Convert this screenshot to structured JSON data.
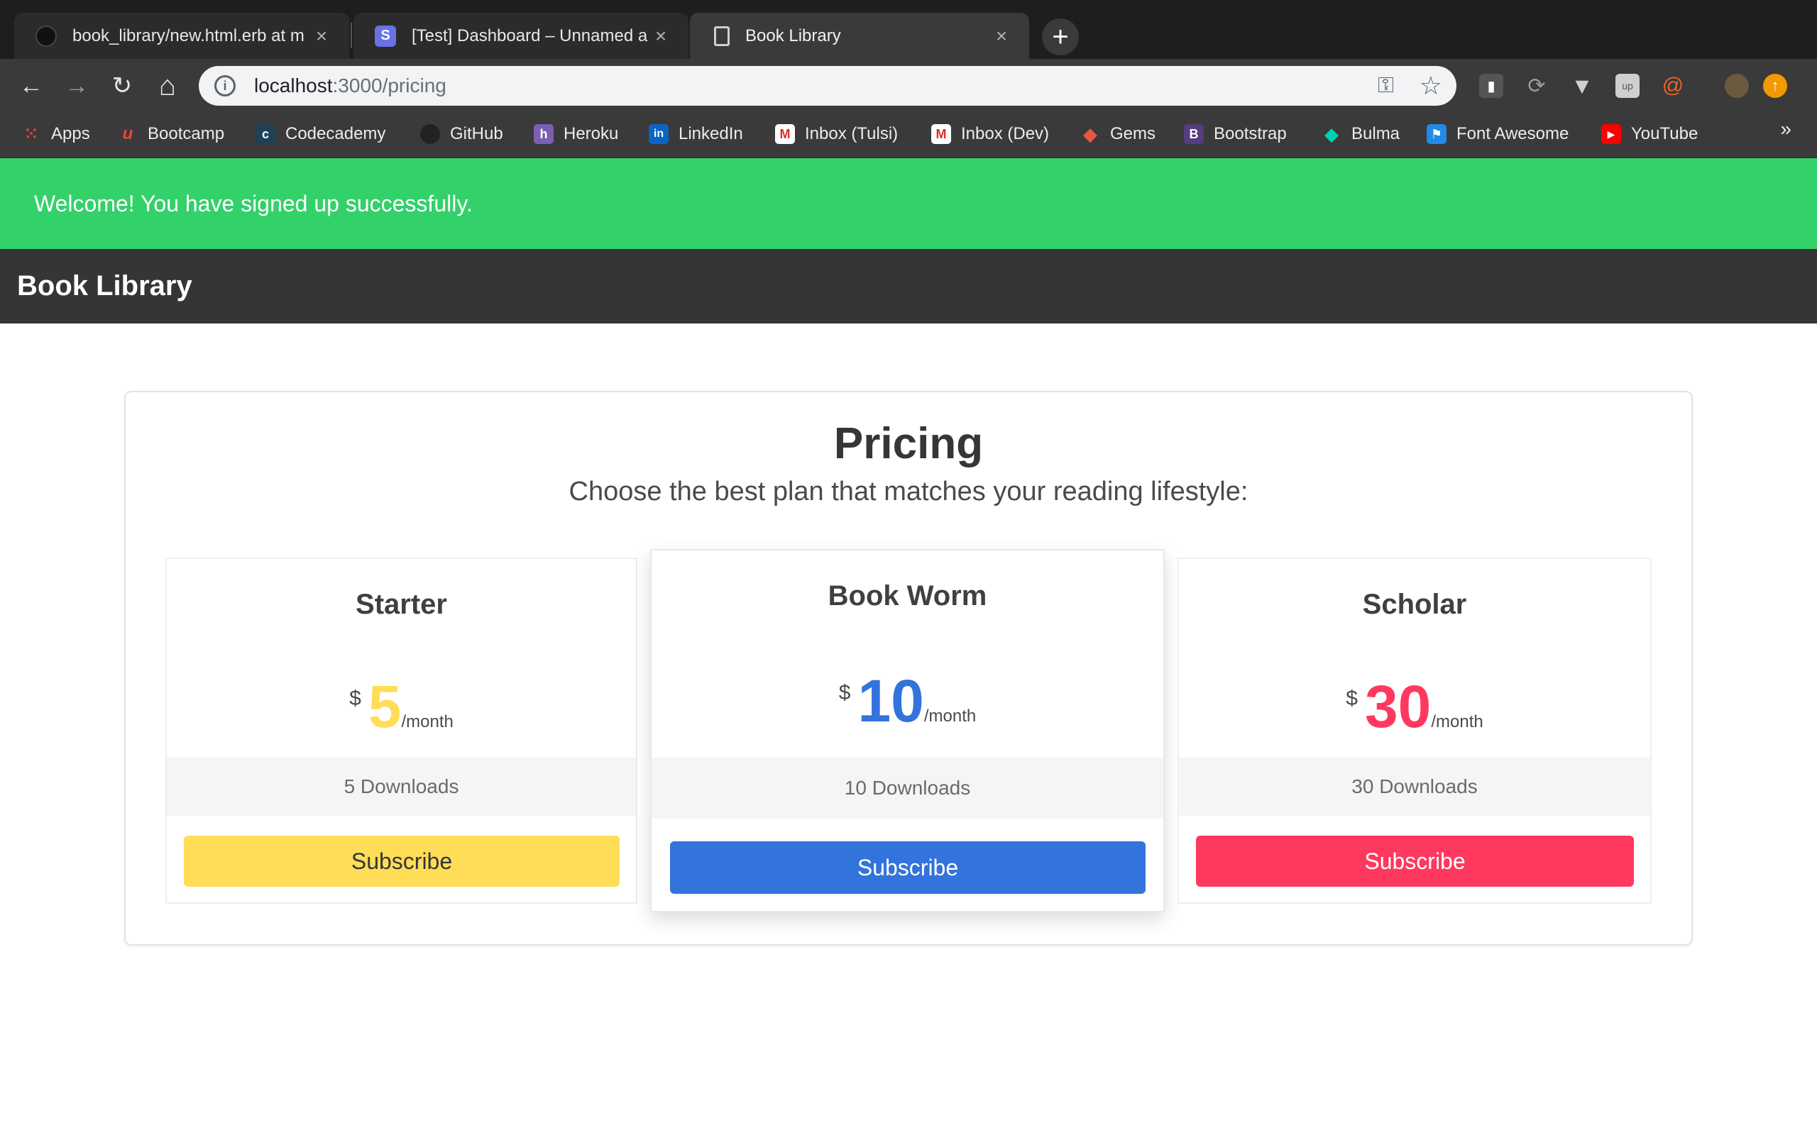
{
  "browser": {
    "tabs": [
      {
        "title": "book_library/new.html.erb at m",
        "icon": "github-icon",
        "active": false
      },
      {
        "title": "[Test] Dashboard – Unnamed a",
        "icon": "stripe-icon",
        "icon_glyph": "S",
        "active": false
      },
      {
        "title": "Book Library",
        "icon": "page-icon",
        "active": true
      }
    ],
    "new_tab_glyph": "+",
    "nav": {
      "back": "←",
      "forward": "→",
      "reload": "↻",
      "home": "⌂"
    },
    "url_host": "localhost",
    "url_rest": ":3000/pricing",
    "bookmarks": [
      {
        "label": "Apps",
        "icon": "apps-grid-icon",
        "color": "#e8453c"
      },
      {
        "label": "Bootcamp",
        "icon": "bootcamp-icon",
        "glyph": "u",
        "color": "#e8453c"
      },
      {
        "label": "Codecademy",
        "icon": "codecademy-icon",
        "glyph": "c",
        "color": "#1f4056"
      },
      {
        "label": "GitHub",
        "icon": "github-icon",
        "color": "#222222"
      },
      {
        "label": "Heroku",
        "icon": "heroku-icon",
        "glyph": "h",
        "color": "#7b5fb0"
      },
      {
        "label": "LinkedIn",
        "icon": "linkedin-icon",
        "glyph": "in",
        "color": "#0a66c2"
      },
      {
        "label": "Inbox (Tulsi)",
        "icon": "gmail-icon",
        "glyph": "M",
        "color": "#d93025"
      },
      {
        "label": "Inbox (Dev)",
        "icon": "gmail-icon",
        "glyph": "M",
        "color": "#d93025"
      },
      {
        "label": "Gems",
        "icon": "rubygems-icon",
        "glyph": "◆",
        "color": "#e9573f"
      },
      {
        "label": "Bootstrap",
        "icon": "bootstrap-icon",
        "glyph": "B",
        "color": "#563d7c"
      },
      {
        "label": "Bulma",
        "icon": "bulma-icon",
        "glyph": "◆",
        "color": "#00d1b2"
      },
      {
        "label": "Font Awesome",
        "icon": "font-awesome-icon",
        "glyph": "⚑",
        "color": "#228ae6"
      },
      {
        "label": "YouTube",
        "icon": "youtube-icon",
        "glyph": "▶",
        "color": "#ff0000"
      }
    ],
    "bookmarks_more": "»"
  },
  "flash": {
    "message": "Welcome! You have signed up successfully."
  },
  "navbar": {
    "brand": "Book Library"
  },
  "pricing": {
    "title": "Pricing",
    "subtitle": "Choose the best plan that matches your reading lifestyle:",
    "plans": [
      {
        "name": "Starter",
        "currency": "$",
        "amount": "5",
        "period": "/month",
        "feature": "5 Downloads",
        "cta": "Subscribe",
        "color": "#ffdd57",
        "cta_text_color": "#363636"
      },
      {
        "name": "Book Worm",
        "currency": "$",
        "amount": "10",
        "period": "/month",
        "feature": "10 Downloads",
        "cta": "Subscribe",
        "color": "#3273dc",
        "cta_text_color": "#ffffff"
      },
      {
        "name": "Scholar",
        "currency": "$",
        "amount": "30",
        "period": "/month",
        "feature": "30 Downloads",
        "cta": "Subscribe",
        "color": "#ff3860",
        "cta_text_color": "#ffffff"
      }
    ]
  }
}
